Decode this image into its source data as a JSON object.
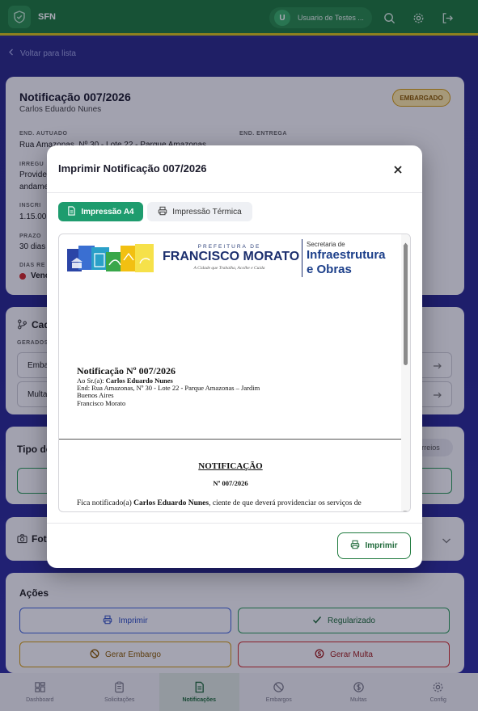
{
  "app": {
    "name": "SFN",
    "user_initial": "U",
    "user_name": "Usuario de Testes ..."
  },
  "back_link": "Voltar para lista",
  "notification": {
    "title": "Notificação 007/2026",
    "name": "Carlos Eduardo Nunes",
    "status": "EMBARGADO",
    "end_autuado_label": "END. AUTUADO",
    "end_autuado_value": "Rua Amazonas, Nº 30 - Lote 22 - Parque Amazonas",
    "end_entrega_label": "END. ENTREGA",
    "irreg_label": "IRREGU",
    "irreg_value_1": "Provide",
    "irreg_value_2": "andame",
    "inscr_label": "INSCRI",
    "inscr_value": "1.15.00",
    "prazo_label": "PRAZO",
    "prazo_value": "30 dias",
    "dias_label": "DIAS RE",
    "dias_value": "Venc"
  },
  "sections": {
    "cadastro": "Cad",
    "gerados": "GERADOS",
    "embargo": "Emba",
    "multa": "Multa",
    "tipo": "Tipo de",
    "correios": "orreios",
    "fotos": "Foto",
    "acoes": "Ações"
  },
  "actions": {
    "imprimir": "Imprimir",
    "regularizado": "Regularizado",
    "gerar_embargo": "Gerar Embargo",
    "gerar_multa": "Gerar Multa"
  },
  "nav": [
    {
      "label": "Dashboard",
      "icon": "dashboard-icon"
    },
    {
      "label": "Solicitações",
      "icon": "clipboard-icon"
    },
    {
      "label": "Notificações",
      "icon": "document-icon"
    },
    {
      "label": "Embargos",
      "icon": "ban-icon"
    },
    {
      "label": "Multas",
      "icon": "dollar-icon"
    },
    {
      "label": "Config",
      "icon": "gear-icon"
    }
  ],
  "modal": {
    "title": "Imprimir Notificação 007/2026",
    "tab_a4": "Impressão A4",
    "tab_thermal": "Impressão Térmica",
    "print_button": "Imprimir",
    "doc": {
      "pref_small": "PREFEITURA DE",
      "pref_big": "FRANCISCO MORATO",
      "slogan": "A Cidade que Trabalha, Acolhe e Cuida",
      "sec_label": "Secretaria de",
      "sec_name_1": "Infraestrutura",
      "sec_name_2": "e Obras",
      "heading": "Notificação Nº 007/2026",
      "to_prefix": "Ao Sr.(a):",
      "to_name": "Carlos Eduardo Nunes",
      "end_line_1": "End: Rua Amazonas, Nº 30 - Lote 22 - Parque Amazonas – Jardim",
      "end_line_2": "Buenos Aires",
      "city": "Francisco Morato",
      "notificacao": "NOTIFICAÇÃO",
      "number": "Nº 007/2026",
      "para_prefix": "Fica notificado(a)",
      "para_name": "Carlos Eduardo Nunes",
      "para_suffix": ", ciente de que deverá providenciar os serviços de"
    }
  },
  "colors": {
    "brand_green": "#1f7a3e",
    "accent_yellow": "#d6c21a",
    "tab_active": "#1e9c6e",
    "embargo_orange": "#d29a10",
    "multa_red": "#d02b2b"
  }
}
